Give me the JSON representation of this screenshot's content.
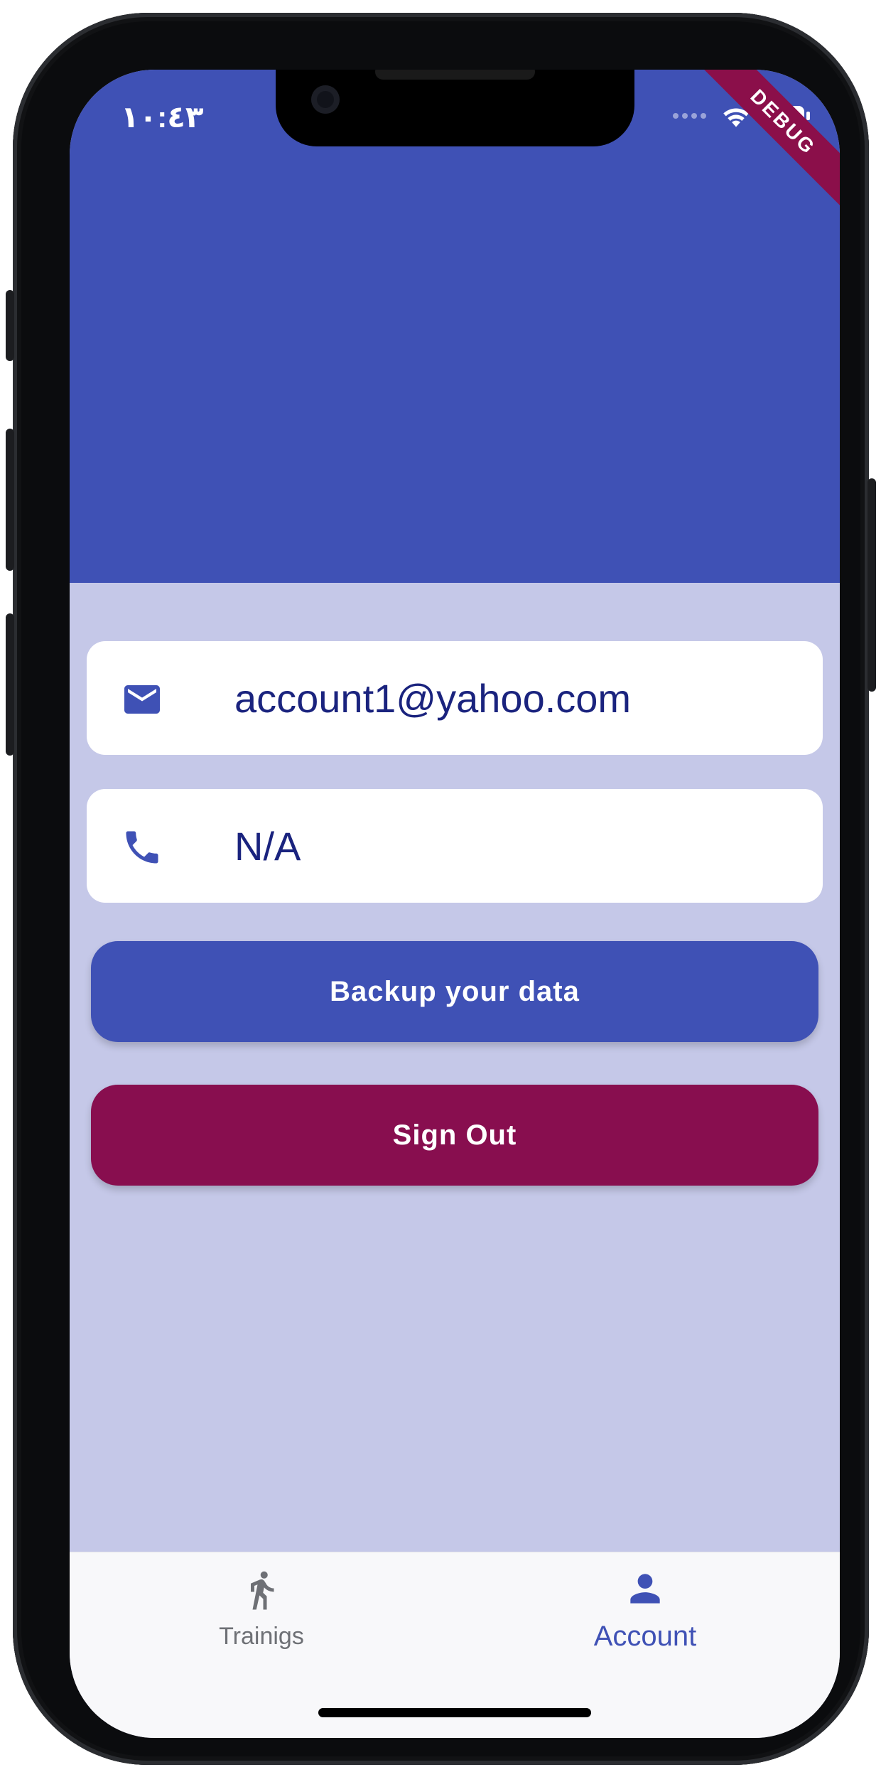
{
  "status_bar": {
    "time": "١٠:٤٣",
    "debug_label": "DEBUG"
  },
  "profile": {
    "email": "account1@yahoo.com",
    "phone": "N/A"
  },
  "actions": {
    "backup_label": "Backup your data",
    "signout_label": "Sign Out"
  },
  "bottom_nav": {
    "items": [
      {
        "label": "Trainigs",
        "icon": "walking-person-icon",
        "selected": false
      },
      {
        "label": "Account",
        "icon": "person-icon",
        "selected": true
      }
    ]
  },
  "colors": {
    "primary": "#3f51b5",
    "background": "#c5c8e8",
    "signout": "#880e4f",
    "text_dark": "#1a237e"
  }
}
